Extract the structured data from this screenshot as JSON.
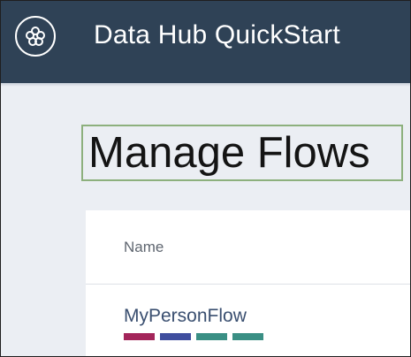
{
  "header": {
    "logo_icon": "data-hub-logo-icon",
    "title": "Data Hub QuickStart",
    "background": "#2f4256"
  },
  "page": {
    "title": "Manage Flows"
  },
  "table": {
    "columns": [
      "Name"
    ],
    "rows": [
      {
        "name": "MyPersonFlow",
        "step_colors": [
          "#a3255a",
          "#3f4e9e",
          "#3a8f84",
          "#3a8f84"
        ]
      }
    ]
  }
}
